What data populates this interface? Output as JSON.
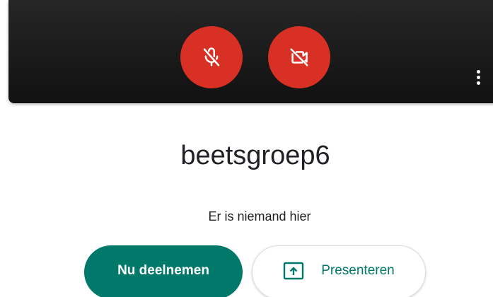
{
  "preview": {
    "mic_button": {
      "icon": "mic-off-icon",
      "state": "muted"
    },
    "camera_button": {
      "icon": "camera-off-icon",
      "state": "off"
    },
    "more_menu": {
      "icon": "more-vertical-icon"
    }
  },
  "meeting": {
    "title": "beetsgroep6",
    "status": "Er is niemand hier"
  },
  "actions": {
    "join_label": "Nu deelnemen",
    "present_label": "Presenteren",
    "present_icon": "present-screen-icon"
  },
  "colors": {
    "danger": "#d93025",
    "primary": "#00796b",
    "preview_bg": "#1a1a1a"
  }
}
